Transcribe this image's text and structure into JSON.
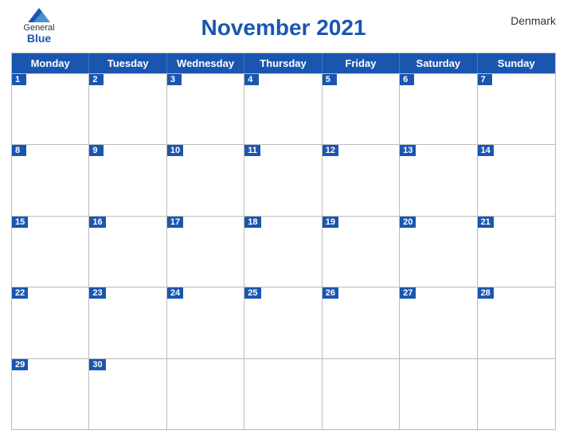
{
  "header": {
    "title": "November 2021",
    "country": "Denmark",
    "logo": {
      "general": "General",
      "blue": "Blue"
    }
  },
  "days": [
    "Monday",
    "Tuesday",
    "Wednesday",
    "Thursday",
    "Friday",
    "Saturday",
    "Sunday"
  ],
  "weeks": [
    [
      {
        "num": "1",
        "empty": false
      },
      {
        "num": "2",
        "empty": false
      },
      {
        "num": "3",
        "empty": false
      },
      {
        "num": "4",
        "empty": false
      },
      {
        "num": "5",
        "empty": false
      },
      {
        "num": "6",
        "empty": false
      },
      {
        "num": "7",
        "empty": false
      }
    ],
    [
      {
        "num": "8",
        "empty": false
      },
      {
        "num": "9",
        "empty": false
      },
      {
        "num": "10",
        "empty": false
      },
      {
        "num": "11",
        "empty": false
      },
      {
        "num": "12",
        "empty": false
      },
      {
        "num": "13",
        "empty": false
      },
      {
        "num": "14",
        "empty": false
      }
    ],
    [
      {
        "num": "15",
        "empty": false
      },
      {
        "num": "16",
        "empty": false
      },
      {
        "num": "17",
        "empty": false
      },
      {
        "num": "18",
        "empty": false
      },
      {
        "num": "19",
        "empty": false
      },
      {
        "num": "20",
        "empty": false
      },
      {
        "num": "21",
        "empty": false
      }
    ],
    [
      {
        "num": "22",
        "empty": false
      },
      {
        "num": "23",
        "empty": false
      },
      {
        "num": "24",
        "empty": false
      },
      {
        "num": "25",
        "empty": false
      },
      {
        "num": "26",
        "empty": false
      },
      {
        "num": "27",
        "empty": false
      },
      {
        "num": "28",
        "empty": false
      }
    ],
    [
      {
        "num": "29",
        "empty": false
      },
      {
        "num": "30",
        "empty": false
      },
      {
        "num": "",
        "empty": true
      },
      {
        "num": "",
        "empty": true
      },
      {
        "num": "",
        "empty": true
      },
      {
        "num": "",
        "empty": true
      },
      {
        "num": "",
        "empty": true
      }
    ]
  ],
  "colors": {
    "blue": "#1a56b0",
    "header_border": "#3a76d0",
    "cell_border": "#bbb"
  }
}
